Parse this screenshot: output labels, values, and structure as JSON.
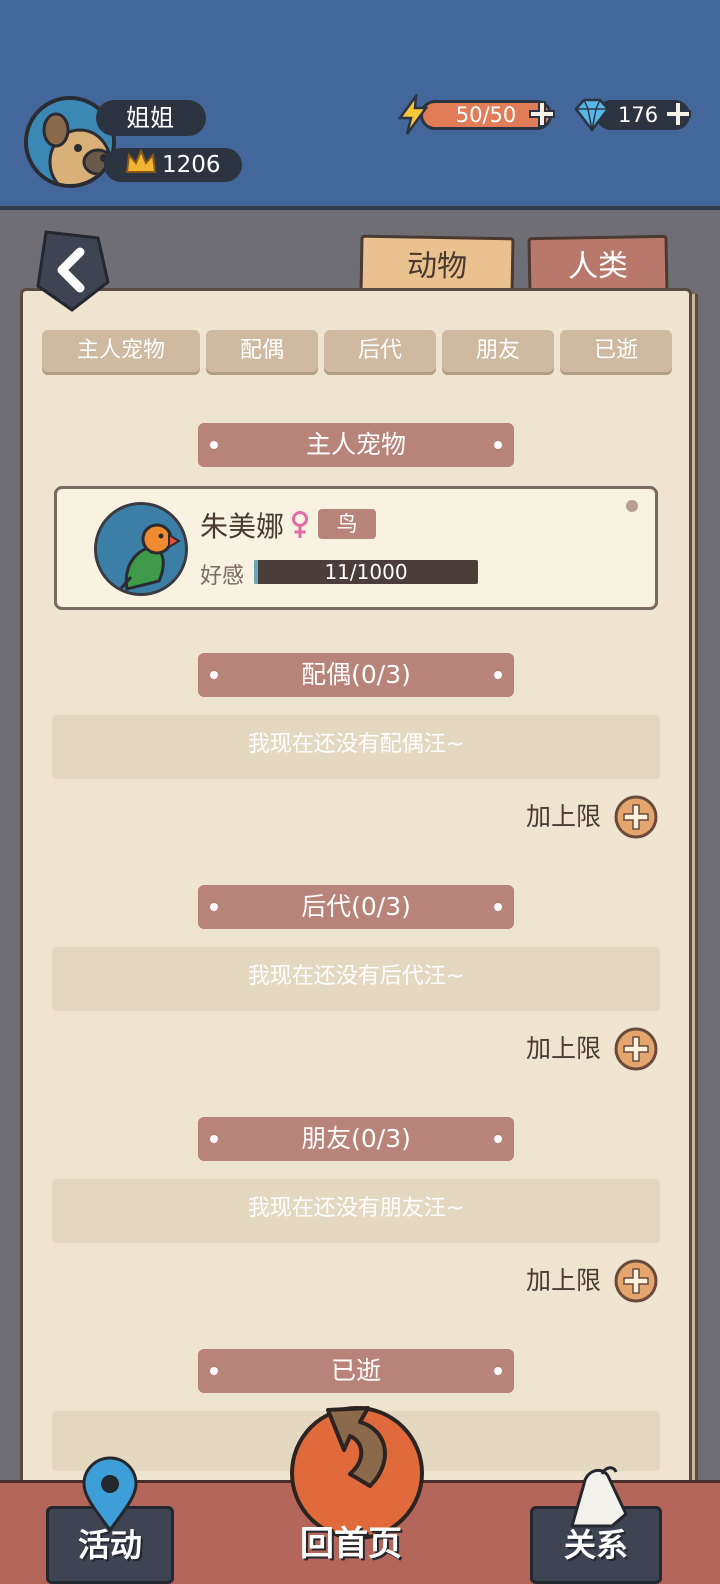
{
  "header": {
    "player_name": "姐姐",
    "crown_score": "1206",
    "energy": "50/50",
    "gems": "176"
  },
  "tabs": {
    "animal": "动物",
    "human": "人类"
  },
  "subtabs": [
    "主人宠物",
    "配偶",
    "后代",
    "朋友",
    "已逝"
  ],
  "sections": {
    "owner_pet": {
      "title": "主人宠物",
      "pet": {
        "name": "朱美娜",
        "species": "鸟",
        "favor_label": "好感",
        "favor_value": "11/1000",
        "favor_fraction": 0.011
      }
    },
    "spouse": {
      "title": "配偶(0/3)",
      "empty_text": "我现在还没有配偶汪~",
      "add_label": "加上限"
    },
    "offspring": {
      "title": "后代(0/3)",
      "empty_text": "我现在还没有后代汪~",
      "add_label": "加上限"
    },
    "friends": {
      "title": "朋友(0/3)",
      "empty_text": "我现在还没有朋友汪~",
      "add_label": "加上限"
    },
    "deceased": {
      "title": "已逝"
    }
  },
  "bottom_nav": {
    "activity": "活动",
    "home": "回首页",
    "relations": "关系"
  },
  "colors": {
    "header_bg": "#43679a",
    "panel_bg": "#efe4cf",
    "section_header": "#b88378",
    "energy_fill": "#e07d58",
    "bottom_nav_bg": "#b5665b"
  }
}
